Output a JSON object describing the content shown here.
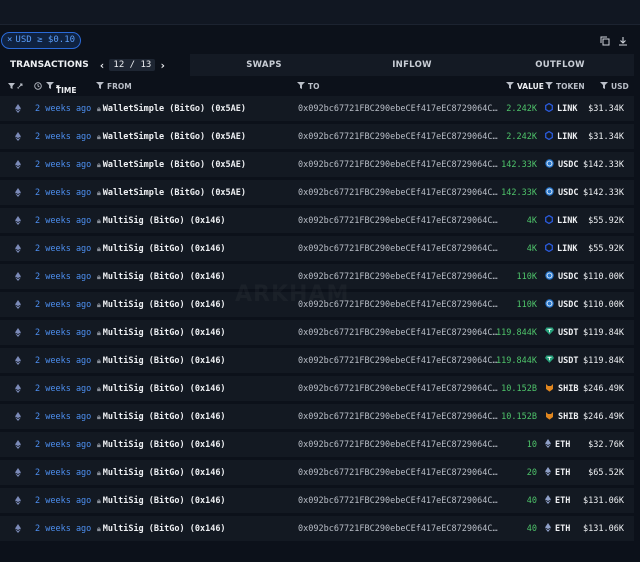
{
  "filter": {
    "close_glyph": "×",
    "label": "USD ≥ $0.10"
  },
  "tabs": {
    "active": "TRANSACTIONS",
    "page": "12 / 13",
    "prev": "‹",
    "next": "›",
    "others": [
      "SWAPS",
      "INFLOW",
      "OUTFLOW"
    ]
  },
  "columns": {
    "time": "TIME",
    "from": "FROM",
    "to": "TO",
    "value": "VALUE",
    "token": "TOKEN",
    "usd": "USD"
  },
  "watermark": "ARKHAM",
  "colors": {
    "link": "#2a5ada",
    "usdc": "#2775ca",
    "usdt": "#26a17b",
    "shib": "#e0861f",
    "eth": "#8fa0c8",
    "value_green": "#4ec36a",
    "time_blue": "#4d8ff0"
  },
  "rows": [
    {
      "time": "2 weeks ago",
      "from": "WalletSimple (BitGo) (0x5AE)",
      "to": "0x092bc67721FBC290ebeCEf417eEC8729064C…",
      "value": "2.242K",
      "token": "LINK",
      "token_icon": "link-icon",
      "usd": "$31.34K"
    },
    {
      "time": "2 weeks ago",
      "from": "WalletSimple (BitGo) (0x5AE)",
      "to": "0x092bc67721FBC290ebeCEf417eEC8729064C…",
      "value": "2.242K",
      "token": "LINK",
      "token_icon": "link-icon",
      "usd": "$31.34K"
    },
    {
      "time": "2 weeks ago",
      "from": "WalletSimple (BitGo) (0x5AE)",
      "to": "0x092bc67721FBC290ebeCEf417eEC8729064C…",
      "value": "142.33K",
      "token": "USDC",
      "token_icon": "usdc-icon",
      "usd": "$142.33K"
    },
    {
      "time": "2 weeks ago",
      "from": "WalletSimple (BitGo) (0x5AE)",
      "to": "0x092bc67721FBC290ebeCEf417eEC8729064C…",
      "value": "142.33K",
      "token": "USDC",
      "token_icon": "usdc-icon",
      "usd": "$142.33K"
    },
    {
      "time": "2 weeks ago",
      "from": "MultiSig (BitGo) (0x146)",
      "to": "0x092bc67721FBC290ebeCEf417eEC8729064C…",
      "value": "4K",
      "token": "LINK",
      "token_icon": "link-icon",
      "usd": "$55.92K"
    },
    {
      "time": "2 weeks ago",
      "from": "MultiSig (BitGo) (0x146)",
      "to": "0x092bc67721FBC290ebeCEf417eEC8729064C…",
      "value": "4K",
      "token": "LINK",
      "token_icon": "link-icon",
      "usd": "$55.92K"
    },
    {
      "time": "2 weeks ago",
      "from": "MultiSig (BitGo) (0x146)",
      "to": "0x092bc67721FBC290ebeCEf417eEC8729064C…",
      "value": "110K",
      "token": "USDC",
      "token_icon": "usdc-icon",
      "usd": "$110.00K"
    },
    {
      "time": "2 weeks ago",
      "from": "MultiSig (BitGo) (0x146)",
      "to": "0x092bc67721FBC290ebeCEf417eEC8729064C…",
      "value": "110K",
      "token": "USDC",
      "token_icon": "usdc-icon",
      "usd": "$110.00K"
    },
    {
      "time": "2 weeks ago",
      "from": "MultiSig (BitGo) (0x146)",
      "to": "0x092bc67721FBC290ebeCEf417eEC8729064C…",
      "value": "119.844K",
      "token": "USDT",
      "token_icon": "usdt-icon",
      "usd": "$119.84K"
    },
    {
      "time": "2 weeks ago",
      "from": "MultiSig (BitGo) (0x146)",
      "to": "0x092bc67721FBC290ebeCEf417eEC8729064C…",
      "value": "119.844K",
      "token": "USDT",
      "token_icon": "usdt-icon",
      "usd": "$119.84K"
    },
    {
      "time": "2 weeks ago",
      "from": "MultiSig (BitGo) (0x146)",
      "to": "0x092bc67721FBC290ebeCEf417eEC8729064C…",
      "value": "10.152B",
      "token": "SHIB",
      "token_icon": "shib-icon",
      "usd": "$246.49K"
    },
    {
      "time": "2 weeks ago",
      "from": "MultiSig (BitGo) (0x146)",
      "to": "0x092bc67721FBC290ebeCEf417eEC8729064C…",
      "value": "10.152B",
      "token": "SHIB",
      "token_icon": "shib-icon",
      "usd": "$246.49K"
    },
    {
      "time": "2 weeks ago",
      "from": "MultiSig (BitGo) (0x146)",
      "to": "0x092bc67721FBC290ebeCEf417eEC8729064C…",
      "value": "10",
      "token": "ETH",
      "token_icon": "eth-icon",
      "usd": "$32.76K"
    },
    {
      "time": "2 weeks ago",
      "from": "MultiSig (BitGo) (0x146)",
      "to": "0x092bc67721FBC290ebeCEf417eEC8729064C…",
      "value": "20",
      "token": "ETH",
      "token_icon": "eth-icon",
      "usd": "$65.52K"
    },
    {
      "time": "2 weeks ago",
      "from": "MultiSig (BitGo) (0x146)",
      "to": "0x092bc67721FBC290ebeCEf417eEC8729064C…",
      "value": "40",
      "token": "ETH",
      "token_icon": "eth-icon",
      "usd": "$131.06K"
    },
    {
      "time": "2 weeks ago",
      "from": "MultiSig (BitGo) (0x146)",
      "to": "0x092bc67721FBC290ebeCEf417eEC8729064C…",
      "value": "40",
      "token": "ETH",
      "token_icon": "eth-icon",
      "usd": "$131.06K"
    }
  ]
}
